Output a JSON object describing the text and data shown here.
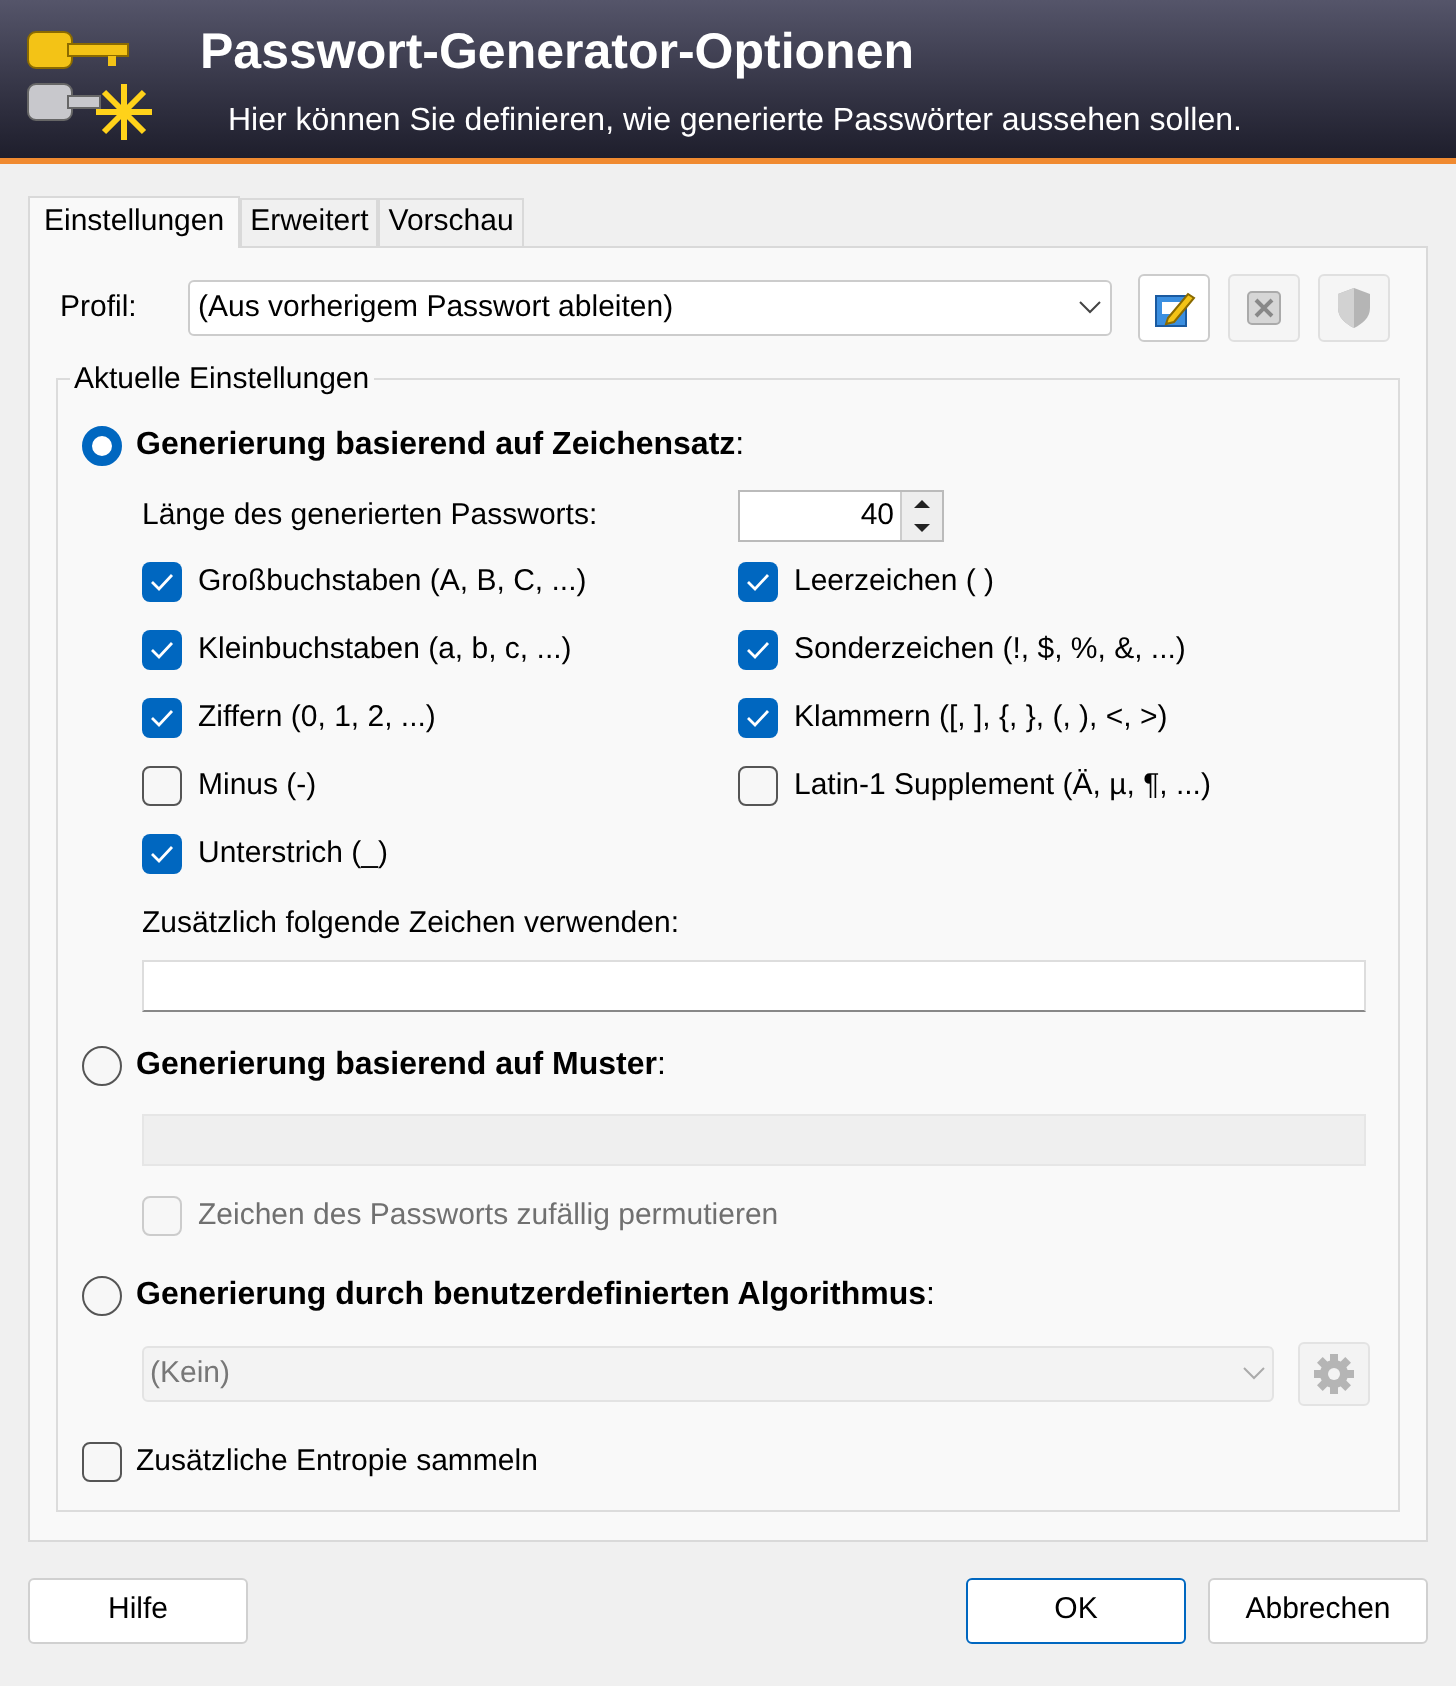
{
  "header": {
    "title": "Passwort-Generator-Optionen",
    "subtitle": "Hier können Sie definieren, wie generierte Passwörter aussehen sollen."
  },
  "tabs": [
    {
      "label": "Einstellungen",
      "selected": true
    },
    {
      "label": "Erweitert",
      "selected": false
    },
    {
      "label": "Vorschau",
      "selected": false
    }
  ],
  "profile": {
    "label": "Profil:",
    "value": "(Aus vorherigem Passwort ableiten)"
  },
  "group": {
    "title": "Aktuelle Einstellungen"
  },
  "charset_mode": {
    "label": "**Generierung basierend auf Zeichensatz**:",
    "selected": true,
    "length_label": "Länge des generierten Passworts:",
    "length_value": "40",
    "options": [
      {
        "label": "Großbuchstaben (A, B, C, ...)",
        "checked": true
      },
      {
        "label": "Leerzeichen ( )",
        "checked": true
      },
      {
        "label": "Kleinbuchstaben (a, b, c, ...)",
        "checked": true
      },
      {
        "label": "Sonderzeichen (!, $, %, &, ...)",
        "checked": true
      },
      {
        "label": "Ziffern (0, 1, 2, ...)",
        "checked": true
      },
      {
        "label": "Klammern ([, ], {, }, (, ), <, >)",
        "checked": true
      },
      {
        "label": "Minus (-)",
        "checked": false
      },
      {
        "label": "Latin-1 Supplement (Ä, µ, ¶, ...)",
        "checked": false
      },
      {
        "label": "Unterstrich (_)",
        "checked": true
      }
    ],
    "extra_label": "Zusätzlich folgende Zeichen verwenden:"
  },
  "pattern_mode": {
    "label": "**Generierung basierend auf Muster**:",
    "selected": false,
    "permute": {
      "label": "Zeichen des Passworts zufällig permutieren",
      "checked": false
    }
  },
  "algorithm_mode": {
    "label": "**Generierung durch benutzerdefinierten Algorithmus**:",
    "selected": false,
    "algorithm": "(Kein)"
  },
  "entropy": {
    "label": "Zusätzliche Entropie sammeln",
    "checked": false
  },
  "buttons": {
    "help": "Hilfe",
    "ok": "OK",
    "cancel": "Abbrechen"
  }
}
